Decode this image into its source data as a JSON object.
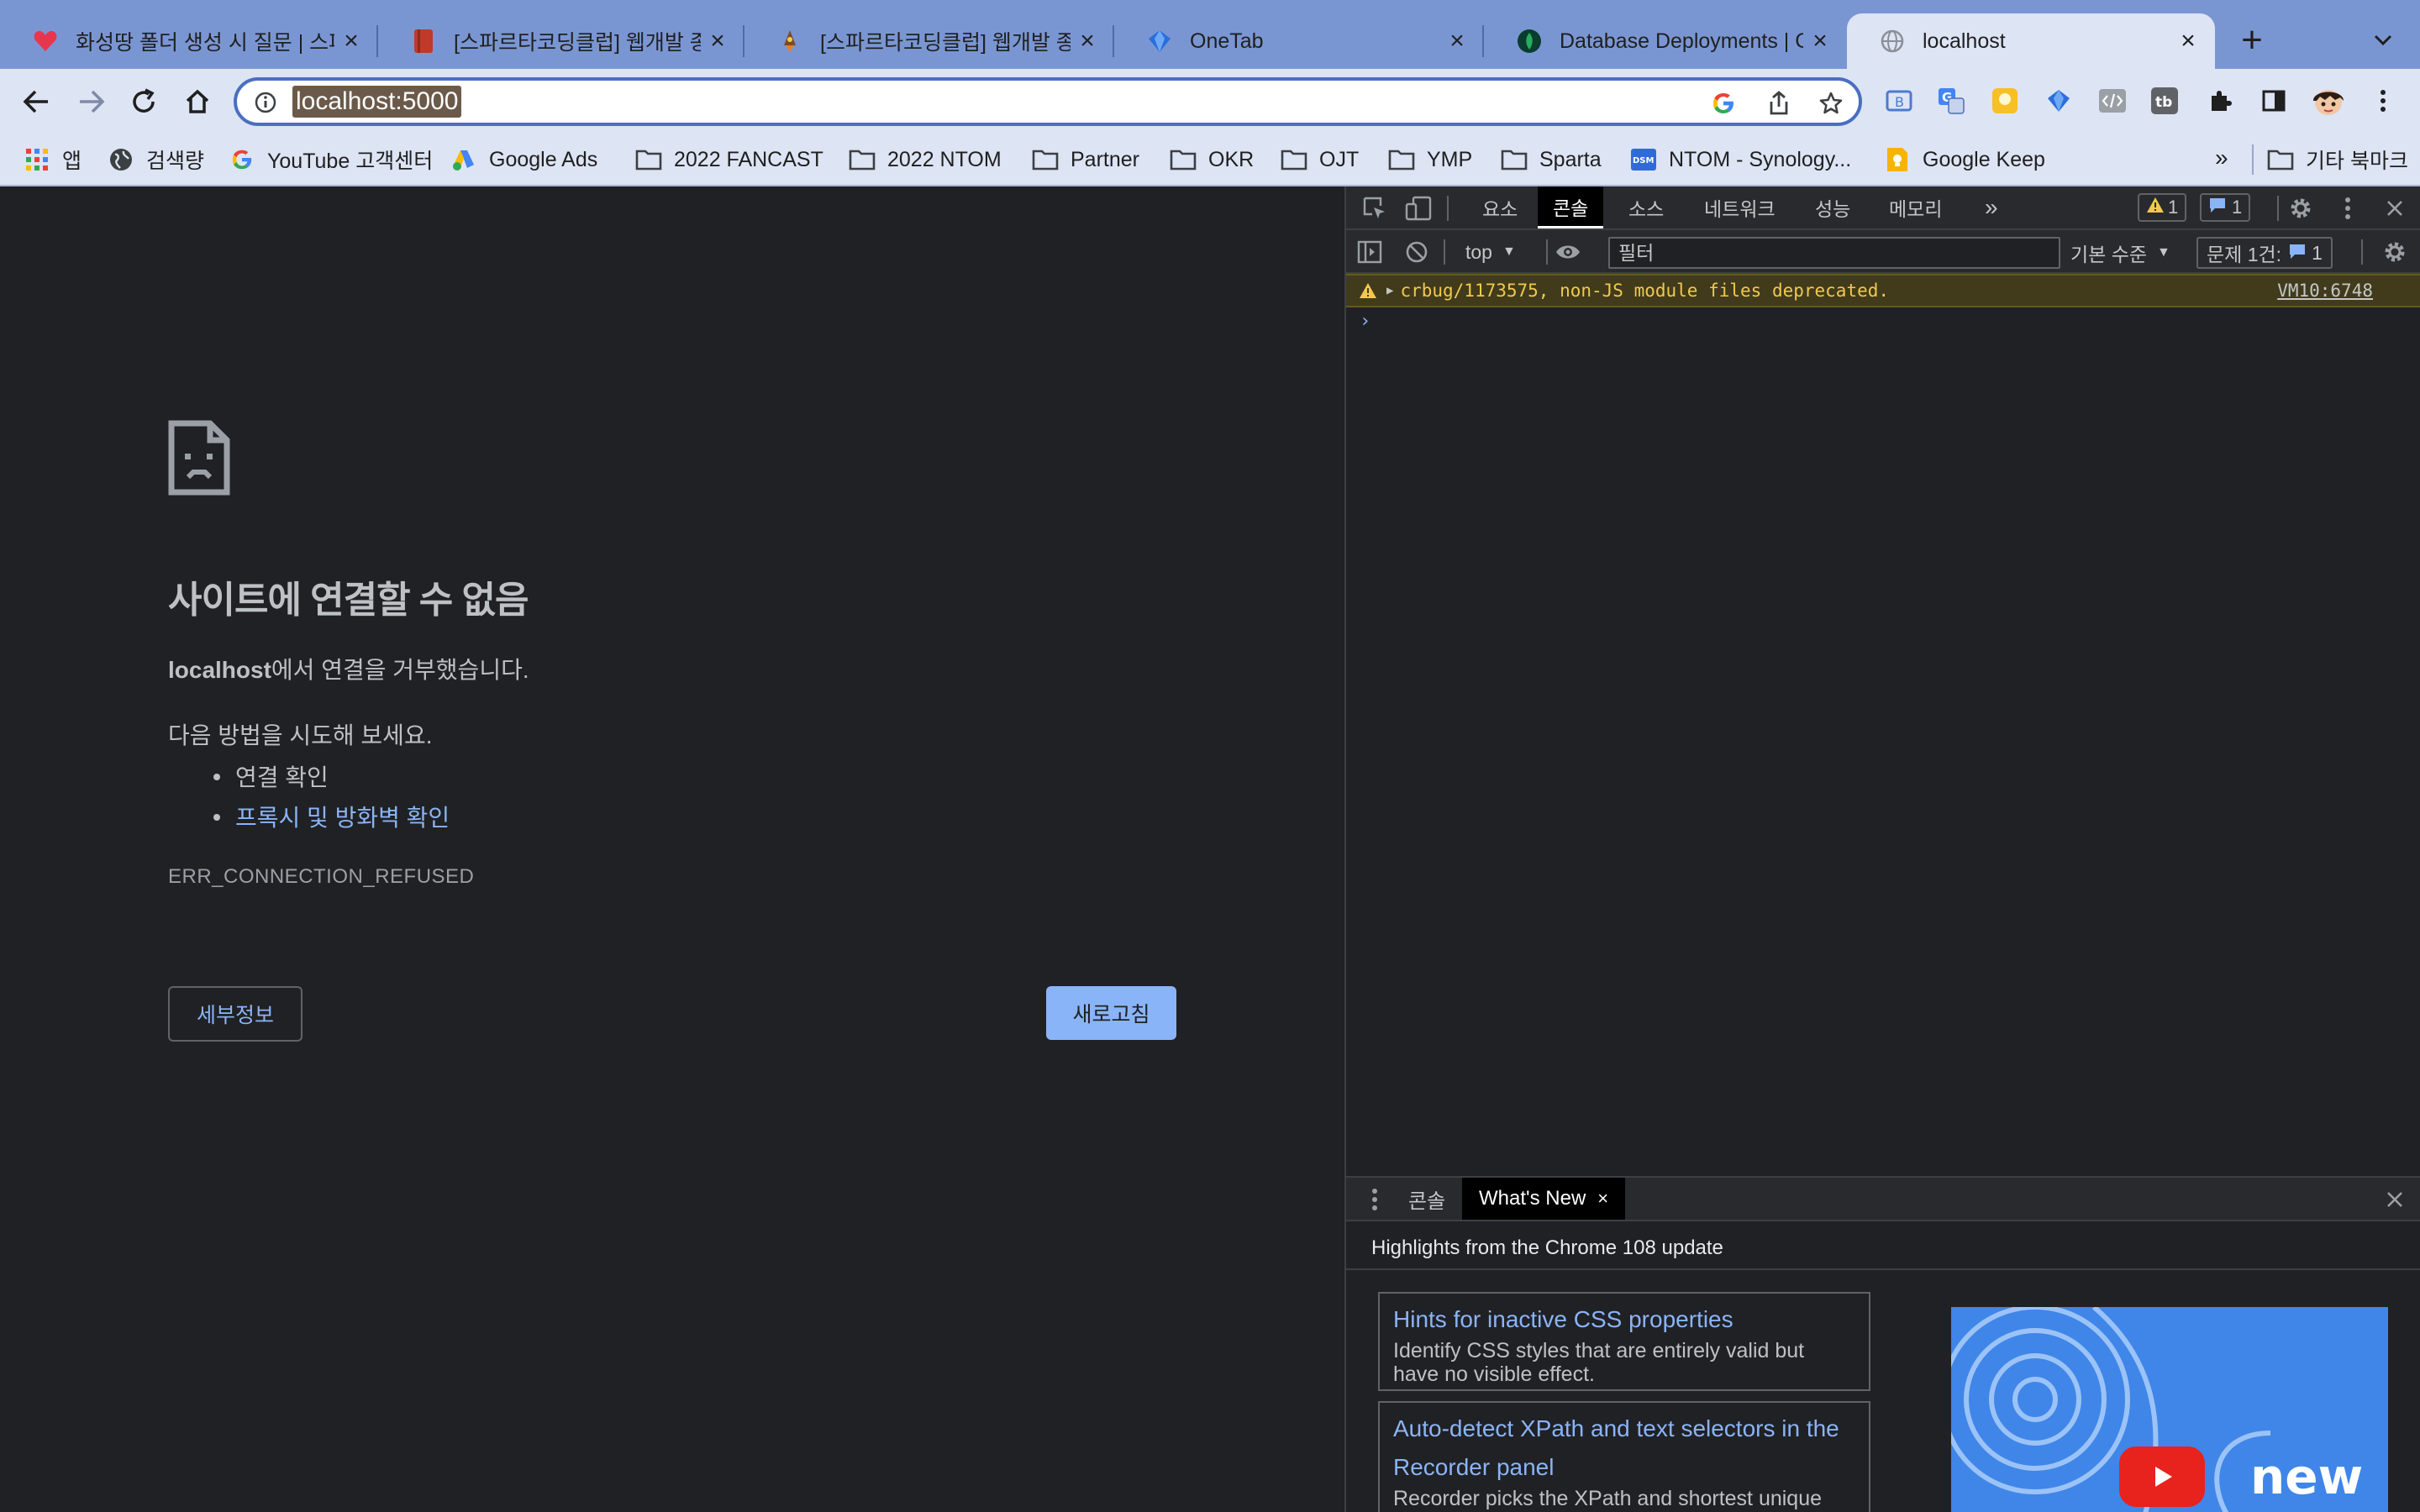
{
  "browser": {
    "tabs": [
      {
        "title": "화성땅 폴더 생성 시 질문 | 스파르",
        "favicon": "sparta-heart-icon"
      },
      {
        "title": "[스파르타코딩클럽] 웹개발 종합반",
        "favicon": "book-icon"
      },
      {
        "title": "[스파르타코딩클럽] 웹개발 종합반",
        "favicon": "rocket-icon"
      },
      {
        "title": "OneTab",
        "favicon": "onetab-icon"
      },
      {
        "title": "Database Deployments | Cl",
        "favicon": "mongodb-leaf-icon"
      },
      {
        "title": "localhost",
        "favicon": "globe-icon",
        "active": true
      }
    ],
    "new_tab": "+",
    "url": "localhost:5000",
    "bookmarks": [
      {
        "label": "앱",
        "icon": "apps-grid-icon"
      },
      {
        "label": "검색량",
        "icon": "globe-dark-icon"
      },
      {
        "label": "YouTube 고객센터",
        "icon": "google-g-icon"
      },
      {
        "label": "Google Ads",
        "icon": "google-ads-icon"
      },
      {
        "label": "2022 FANCAST",
        "icon": "folder-icon"
      },
      {
        "label": "2022 NTOM",
        "icon": "folder-icon"
      },
      {
        "label": "Partner",
        "icon": "folder-icon"
      },
      {
        "label": "OKR",
        "icon": "folder-icon"
      },
      {
        "label": "OJT",
        "icon": "folder-icon"
      },
      {
        "label": "YMP",
        "icon": "folder-icon"
      },
      {
        "label": "Sparta",
        "icon": "folder-icon"
      },
      {
        "label": "NTOM - Synology...",
        "icon": "dsm-icon"
      },
      {
        "label": "Google Keep",
        "icon": "keep-icon"
      }
    ],
    "bookmarks_more": "»",
    "other_bookmarks": "기타 북마크",
    "colors": {
      "accent": "#4a6fc1",
      "link": "#8ab4f8"
    }
  },
  "error_page": {
    "title": "사이트에 연결할 수 없음",
    "host": "localhost",
    "message_suffix": "에서 연결을 거부했습니다.",
    "try_text": "다음 방법을 시도해 보세요.",
    "suggestions": [
      "연결 확인",
      "프록시 및 방화벽 확인"
    ],
    "error_code": "ERR_CONNECTION_REFUSED",
    "details_button": "세부정보",
    "reload_button": "새로고침"
  },
  "devtools": {
    "tabs": [
      "요소",
      "콘솔",
      "소스",
      "네트워크",
      "성능",
      "메모리"
    ],
    "active_tab": "콘솔",
    "more_tabs": "»",
    "warning_count": "1",
    "message_count": "1",
    "context": "top",
    "filter_placeholder": "필터",
    "log_level": "기본 수준",
    "issues_label": "문제 1건:",
    "issues_count": "1",
    "console_warning": "crbug/1173575, non-JS module files deprecated.",
    "console_warning_source": "VM10:6748",
    "prompt": "›",
    "drawer": {
      "tabs": [
        "콘솔",
        "What's New"
      ],
      "close": "×",
      "heading": "Highlights from the Chrome 108 update",
      "cards": [
        {
          "title": "Hints for inactive CSS properties",
          "desc": "Identify CSS styles that are entirely valid but have no visible effect."
        },
        {
          "title": "Auto-detect XPath and text selectors in the Recorder panel",
          "desc": "Recorder picks the XPath and shortest unique text of an element as its selector."
        }
      ],
      "promo_text": "new"
    }
  }
}
